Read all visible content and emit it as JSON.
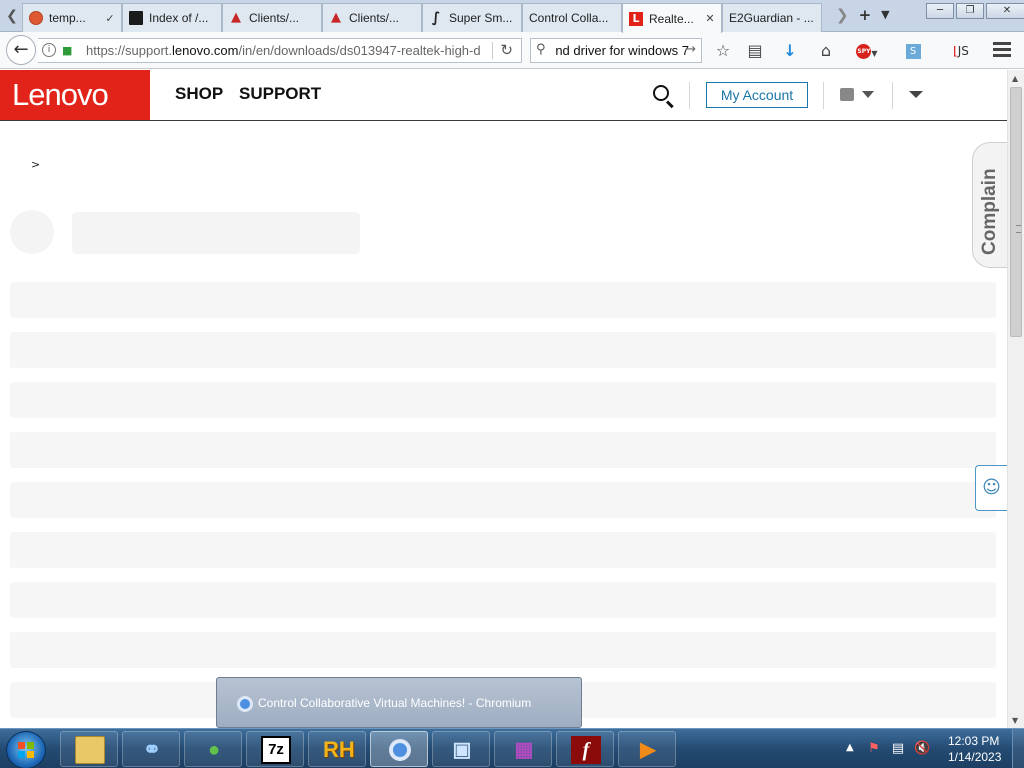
{
  "browser": {
    "tabs": [
      {
        "title": "temp...",
        "icon": "duckduckgo-icon",
        "extra": "pin-icon"
      },
      {
        "title": "Index of /...",
        "icon": "folder-icon",
        "extra": ""
      },
      {
        "title": "Clients/...",
        "icon": "clients-icon",
        "extra": ""
      },
      {
        "title": "Clients/...",
        "icon": "clients-icon",
        "extra": ""
      },
      {
        "title": "Super Sm...",
        "icon": "supersmall-icon",
        "extra": ""
      },
      {
        "title": "Control Colla...",
        "icon": "",
        "extra": ""
      },
      {
        "title": "Realte...",
        "icon": "lenovo-favicon",
        "extra": "close-icon",
        "active": true
      },
      {
        "title": "E2Guardian - ...",
        "icon": "",
        "extra": ""
      }
    ],
    "favicon_lenovo_letter": "L",
    "new_tab_label": "+",
    "url": {
      "prefix": "https://support.",
      "domain": "lenovo.com",
      "suffix": "/in/en/downloads/ds013947-realtek-high-d"
    },
    "search_text": "ınd driver for windows 7"
  },
  "site": {
    "logo": "Lenovo",
    "nav": [
      "SHOP",
      "SUPPORT"
    ],
    "account_button": "My Account",
    "breadcrumb": ">",
    "complain_label": "Complain",
    "feedback_icon": "smiley-icon",
    "accent_color": "#1976a8",
    "brand_color": "#e2231a"
  },
  "taskbar": {
    "popup_title": "Control Collaborative Virtual Machines! - Chromium",
    "apps": [
      {
        "name": "explorer",
        "label": ""
      },
      {
        "name": "network-tool",
        "label": ""
      },
      {
        "name": "messenger",
        "label": ""
      },
      {
        "name": "7zip",
        "label": "7z"
      },
      {
        "name": "resource-hacker",
        "label": "RH"
      },
      {
        "name": "chromium",
        "label": ""
      },
      {
        "name": "remote-desktop",
        "label": ""
      },
      {
        "name": "winrar",
        "label": ""
      },
      {
        "name": "flash",
        "label": "f"
      },
      {
        "name": "media-player",
        "label": ""
      }
    ],
    "clock_time": "12:03 PM",
    "clock_date": "1/14/2023"
  }
}
